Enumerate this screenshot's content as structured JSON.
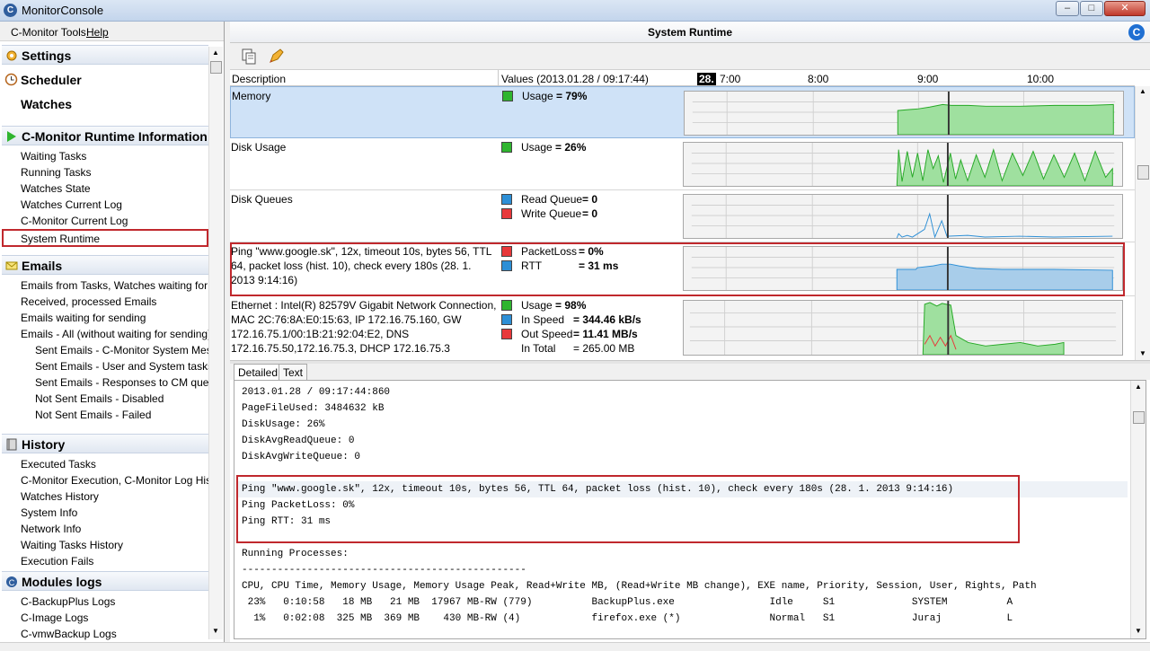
{
  "window": {
    "title": "MonitorConsole",
    "app_icon": "C"
  },
  "menu": {
    "tools": "C-Monitor Tools",
    "help": "Help"
  },
  "sidebar": {
    "settings": {
      "title": "Settings"
    },
    "scheduler": "Scheduler",
    "watches": "Watches",
    "runtime": {
      "title": "C-Monitor Runtime Information",
      "items": [
        "Waiting Tasks",
        "Running Tasks",
        "Watches State",
        "Watches Current Log",
        "C-Monitor Current Log",
        "System Runtime"
      ]
    },
    "emails": {
      "title": "Emails",
      "items": [
        "Emails from Tasks, Watches waiting for sending",
        "Received, processed Emails",
        "Emails waiting for sending",
        "Emails - All (without waiting for sending)"
      ],
      "subitems": [
        "Sent Emails - C-Monitor System Messages",
        "Sent Emails - User and System tasks Results",
        "Sent Emails - Responses to CM queries",
        "Not Sent Emails - Disabled",
        "Not Sent Emails - Failed"
      ]
    },
    "history": {
      "title": "History",
      "items": [
        "Executed Tasks",
        "C-Monitor Execution, C-Monitor Log History",
        "Watches History",
        "System Info",
        "Network Info",
        "Waiting Tasks History",
        "Execution Fails"
      ]
    },
    "modules": {
      "title": "Modules logs",
      "items": [
        "C-BackupPlus Logs",
        "C-Image Logs",
        "C-vmwBackup Logs"
      ]
    }
  },
  "panel": {
    "title": "System Runtime",
    "badge": "C"
  },
  "columns": {
    "description": "Description",
    "values": "Values (2013.01.28 / 09:17:44)",
    "day": "28.",
    "times": [
      "7:00",
      "8:00",
      "9:00",
      "10:00"
    ]
  },
  "rows": [
    {
      "desc": "Memory",
      "values": [
        {
          "label": "Usage",
          "value": "= 79%",
          "color": "#2fb52f"
        }
      ]
    },
    {
      "desc": "Disk Usage",
      "values": [
        {
          "label": "Usage",
          "value": "= 26%",
          "color": "#2fb52f"
        }
      ]
    },
    {
      "desc": "Disk Queues",
      "values": [
        {
          "label": "Read Queue",
          "value": "= 0",
          "color": "#2d8fd6"
        },
        {
          "label": "Write Queue",
          "value": "= 0",
          "color": "#e8383a"
        }
      ]
    },
    {
      "desc": "Ping \"www.google.sk\", 12x, timeout 10s, bytes 56, TTL 64, packet loss (hist. 10), check every 180s (28. 1. 2013 9:14:16)",
      "values": [
        {
          "label": "PacketLoss",
          "value": "= 0%",
          "color": "#e8383a"
        },
        {
          "label": "RTT",
          "value": "= 31 ms",
          "color": "#2d8fd6"
        }
      ]
    },
    {
      "desc": "Ethernet : Intel(R) 82579V Gigabit Network Connection, MAC 2C:76:8A:E0:15:63, IP 172.16.75.160, GW 172.16.75.1/00:1B:21:92:04:E2, DNS 172.16.75.50,172.16.75.3, DHCP 172.16.75.3",
      "values": [
        {
          "label": "Usage",
          "value": "= 98%",
          "color": "#2fb52f"
        },
        {
          "label": "In Speed",
          "value": "= 344.46 kB/s",
          "color": "#2d8fd6"
        },
        {
          "label": "Out Speed",
          "value": "= 11.41 MB/s",
          "color": "#e8383a"
        },
        {
          "label": "In Total",
          "value": "= 265.00 MB",
          "color": ""
        }
      ]
    }
  ],
  "tabs": {
    "detailed": "Detailed",
    "text": "Text"
  },
  "detail_lines": [
    "2013.01.28 / 09:17:44:860",
    "PageFileUsed: 3484632 kB",
    "DiskUsage: 26%",
    "DiskAvgReadQueue: 0",
    "DiskAvgWriteQueue: 0",
    "",
    "Ping \"www.google.sk\", 12x, timeout 10s, bytes 56, TTL 64, packet loss (hist. 10), check every 180s (28. 1. 2013 9:14:16)",
    "Ping PacketLoss: 0%",
    "Ping RTT: 31 ms",
    "",
    "Running Processes:",
    "------------------------------------------------",
    "CPU, CPU Time, Memory Usage, Memory Usage Peak, Read+Write MB, (Read+Write MB change), EXE name, Priority, Session, User, Rights, Path",
    " 23%   0:10:58   18 MB   21 MB  17967 MB-RW (779)          BackupPlus.exe                Idle     S1             SYSTEM          A",
    "  1%   0:02:08  325 MB  369 MB    430 MB-RW (4)            firefox.exe (*)               Normal   S1             Juraj           L"
  ]
}
